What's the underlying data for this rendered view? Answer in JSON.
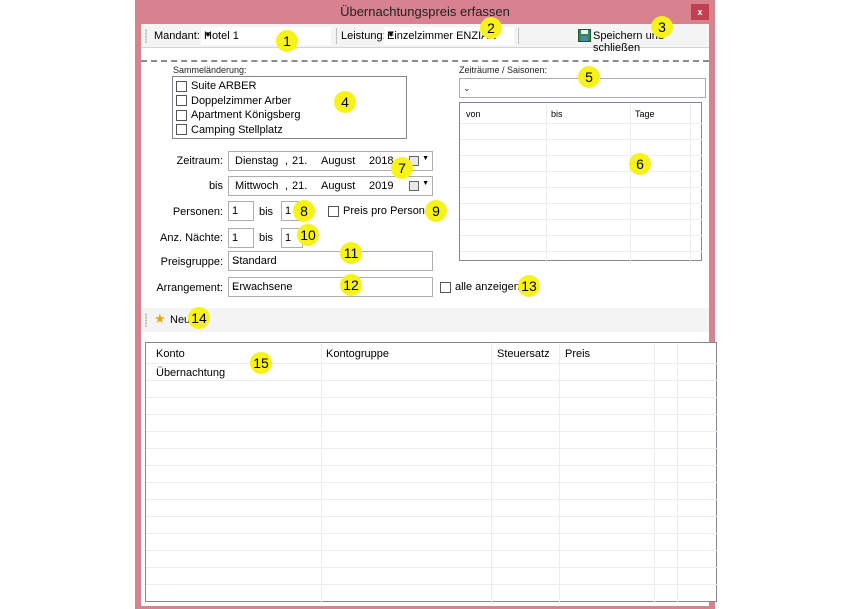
{
  "window": {
    "title": "Übernachtungspreis erfassen",
    "close_label": "x"
  },
  "toolbar": {
    "mandant_label": "Mandant:",
    "mandant_value": "Hotel 1",
    "leistung_label": "Leistung:",
    "leistung_value": "Einzelzimmer ENZIAN",
    "save_label": "Speichern und schließen"
  },
  "sammel": {
    "label": "Sammeländerung:",
    "items": [
      "Suite ARBER",
      "Doppelzimmer Arber",
      "Apartment Königsberg",
      "Camping Stellplatz"
    ]
  },
  "zeitraum": {
    "label": "Zeitraum:",
    "from": {
      "weekday": "Dienstag",
      "day": "21.",
      "month": "August",
      "year": "2018"
    },
    "bis_label": "bis",
    "to": {
      "weekday": "Mittwoch",
      "day": "21.",
      "month": "August",
      "year": "2019"
    }
  },
  "personen": {
    "label": "Personen:",
    "from": "1",
    "bis_label": "bis",
    "to": "1",
    "checkbox_label": "Preis pro Person"
  },
  "naechte": {
    "label": "Anz. Nächte:",
    "from": "1",
    "bis_label": "bis",
    "to": "1"
  },
  "preisgruppe": {
    "label": "Preisgruppe:",
    "value": "Standard"
  },
  "arrangement": {
    "label": "Arrangement:",
    "value": "Erwachsene",
    "checkbox_label": "alle anzeigen"
  },
  "seasons": {
    "label": "Zeiträume / Saisonen:",
    "columns": [
      "von",
      "bis",
      "Tage"
    ]
  },
  "toolbar2": {
    "new_label": "Neu"
  },
  "grid": {
    "columns": [
      "Konto",
      "Kontogruppe",
      "Steuersatz",
      "Preis"
    ],
    "rows": [
      [
        "Übernachtung",
        "",
        "",
        ""
      ]
    ]
  },
  "markers": [
    "1",
    "2",
    "3",
    "4",
    "5",
    "6",
    "7",
    "8",
    "9",
    "10",
    "11",
    "12",
    "13",
    "14",
    "15"
  ]
}
